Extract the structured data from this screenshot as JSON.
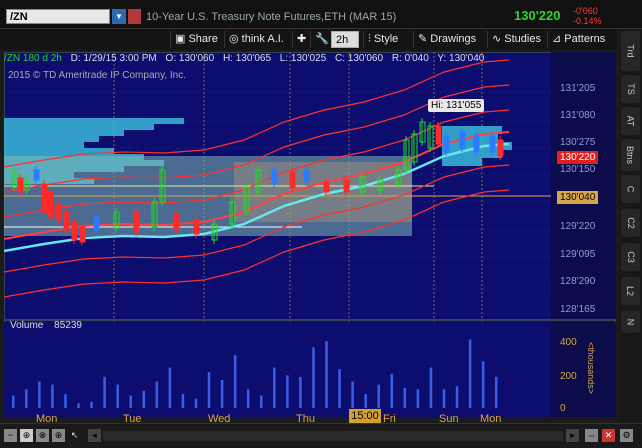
{
  "titlebar": {
    "symbol": "/ZN",
    "description": "10-Year U.S. Treasury Note Futures,ETH (MAR 15)",
    "last_price": "130'220",
    "change_abs": "-0'060",
    "change_pct": "-0.14%"
  },
  "toolbar": {
    "share": "Share",
    "think_ai": "think A.I.",
    "timeframe": "2h",
    "style": "Style",
    "drawings": "Drawings",
    "studies": "Studies",
    "patterns": "Patterns"
  },
  "side_tabs": [
    "Trd",
    "TS",
    "AT",
    "Btns",
    "C",
    "C2",
    "C3",
    "L2",
    "N"
  ],
  "info_bar": {
    "symbol": "/ZN 180 d 2h",
    "date": "D: 1/29/15 3:00 PM",
    "open": "O: 130'060",
    "high": "H: 130'065",
    "low": "L: 130'025",
    "close": "C: 130'060",
    "range": "R: 0'040",
    "y": "Y: 130'040"
  },
  "copyright": "2015 © TD Ameritrade IP Company, Inc.",
  "price_axis": [
    "131'205",
    "131'080",
    "130'275",
    "130'150",
    "130'025",
    "129'220",
    "129'095",
    "128'290",
    "128'165"
  ],
  "hi_badge": "Hi: 131'055",
  "current_price_badge": "130'220",
  "cursor_price_badge": "130'040",
  "volume": {
    "label": "Volume",
    "value": "85239",
    "axis": [
      "400",
      "200",
      "0"
    ],
    "unit": "<thousands>"
  },
  "x_axis": [
    "Mon",
    "Tue",
    "Wed",
    "Thu",
    "Fri",
    "Sun",
    "Mon"
  ],
  "time_badge": "15:00",
  "colors": {
    "chart_bg": "#0d0d70",
    "up_candle": "#22dd22",
    "down_candle": "#ff2a2a",
    "neutral_candle": "#2a7bff",
    "ma_line": "#66e8ee",
    "bands": "#ff3030",
    "volume": "#3a5ee6",
    "axis_text": "#d8a64a"
  },
  "chart_data": [
    {
      "type": "line",
      "candles_approx": [
        {
          "x": "Mon",
          "close": 129.6
        },
        {
          "x": "Tue",
          "close": 129.55
        },
        {
          "x": "Wed",
          "close": 129.7
        },
        {
          "x": "Thu",
          "close": 130.03
        },
        {
          "x": "Fri",
          "close": 130.6
        },
        {
          "x": "Sun",
          "close": 130.78
        },
        {
          "x": "Mon",
          "close": 130.69
        }
      ]
    },
    {
      "type": "bar",
      "values": [
        80,
        120,
        170,
        150,
        90,
        30,
        40,
        200,
        150,
        80,
        110,
        170,
        260,
        90,
        60,
        230,
        180,
        340,
        120,
        80,
        260,
        210,
        200,
        390,
        430,
        250,
        170,
        90,
        150,
        220,
        130,
        120,
        260,
        120,
        140,
        440,
        300,
        200
      ]
    }
  ]
}
